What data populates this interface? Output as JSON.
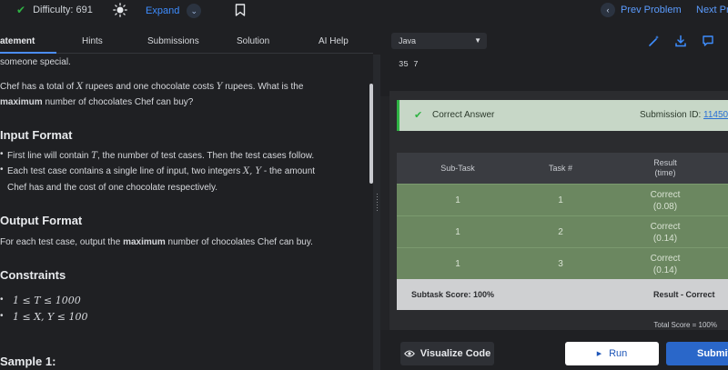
{
  "header": {
    "difficulty_label": "Difficulty: 691",
    "expand_label": "Expand",
    "prev_label": "Prev Problem",
    "next_label": "Next Pr"
  },
  "tabs": [
    "atement",
    "Hints",
    "Submissions",
    "Solution",
    "AI Help"
  ],
  "statement": {
    "intro_cont": "someone special.",
    "p1_a": "Chef has a total of ",
    "p1_x": "X",
    "p1_b": " rupees and one chocolate costs ",
    "p1_y": "Y",
    "p1_c": " rupees. What is the",
    "p1_bold": "maximum",
    "p1_d": " number of chocolates Chef can buy?",
    "input_heading": "Input Format",
    "in1_a": "First line will contain ",
    "in1_t": "T",
    "in1_b": ", the number of test cases. Then the test cases follow.",
    "in2_a": "Each test case contains a single line of input, two integers ",
    "in2_xy": "X, Y",
    "in2_b": " - the amount",
    "in2_c": "Chef has and the cost of one chocolate respectively.",
    "output_heading": "Output Format",
    "out_a": "For each test case, output the ",
    "out_bold": "maximum",
    "out_b": " number of chocolates Chef can buy.",
    "constraints_heading": "Constraints",
    "c1": "1 ≤ T ≤ 1000",
    "c2": "1 ≤ X, Y ≤ 100",
    "sample_heading": "Sample 1:"
  },
  "editor": {
    "language": "Java",
    "io_text": "35 7"
  },
  "result": {
    "verdict": "Correct Answer",
    "submission_label": "Submission ID: ",
    "submission_id": "11450",
    "columns": [
      "Sub-Task",
      "Task #",
      "Result\n(time)"
    ],
    "rows": [
      {
        "subtask": "1",
        "task": "1",
        "result": "Correct",
        "time": "(0.08)"
      },
      {
        "subtask": "1",
        "task": "2",
        "result": "Correct",
        "time": "(0.14)"
      },
      {
        "subtask": "1",
        "task": "3",
        "result": "Correct",
        "time": "(0.14)"
      }
    ],
    "subtask_score": "Subtask Score: 100%",
    "result_summary": "Result - Correct",
    "total_score": "Total Score = 100%"
  },
  "actions": {
    "visualize": "Visualize Code",
    "run": "Run",
    "submit": "Submit"
  },
  "colors": {
    "accent_blue": "#2a67c9",
    "success_green": "#2fb344",
    "row_green": "#6b8760"
  }
}
